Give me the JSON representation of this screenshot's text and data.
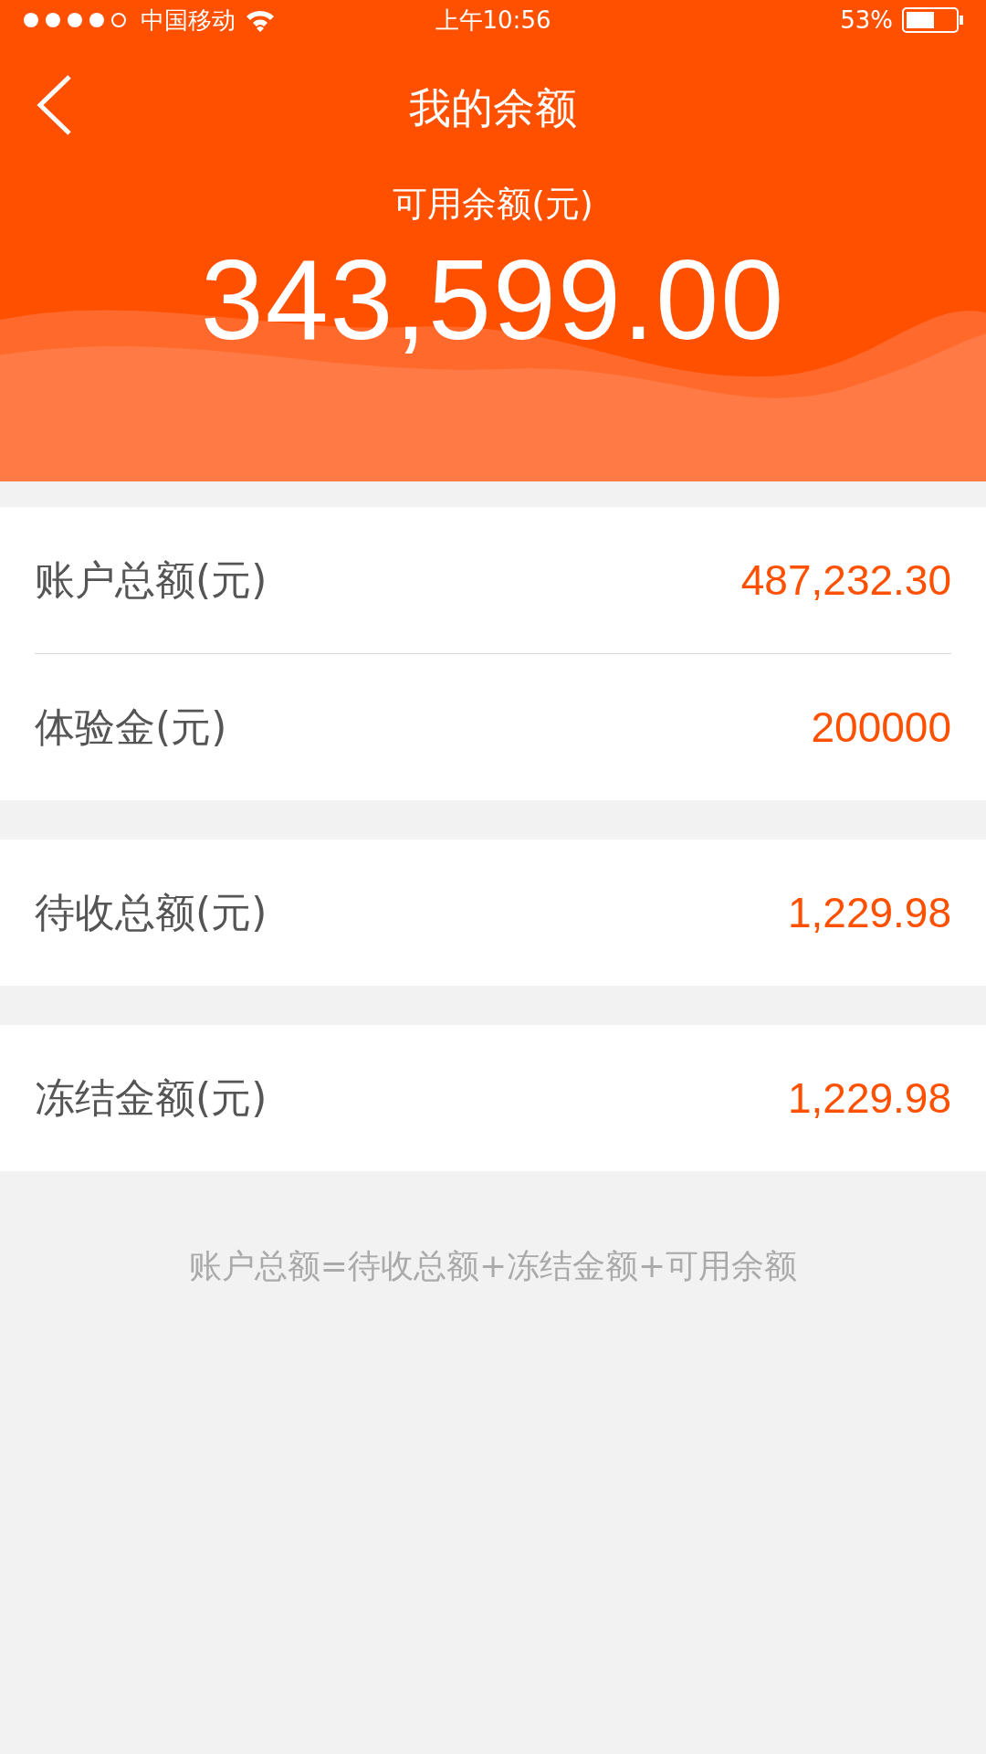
{
  "status_bar": {
    "carrier": "中国移动",
    "time": "上午10:56",
    "battery": "53%"
  },
  "header": {
    "title": "我的余额",
    "balance_label": "可用余额(元)",
    "balance": "343,599.00"
  },
  "groups": [
    {
      "rows": [
        {
          "label": "账户总额(元)",
          "value": "487,232.30"
        },
        {
          "label": "体验金(元)",
          "value": "200000"
        }
      ]
    },
    {
      "rows": [
        {
          "label": "待收总额(元)",
          "value": "1,229.98"
        }
      ]
    },
    {
      "rows": [
        {
          "label": "冻结金额(元)",
          "value": "1,229.98"
        }
      ]
    }
  ],
  "footnote": "账户总额=待收总额+冻结金额+可用余额"
}
